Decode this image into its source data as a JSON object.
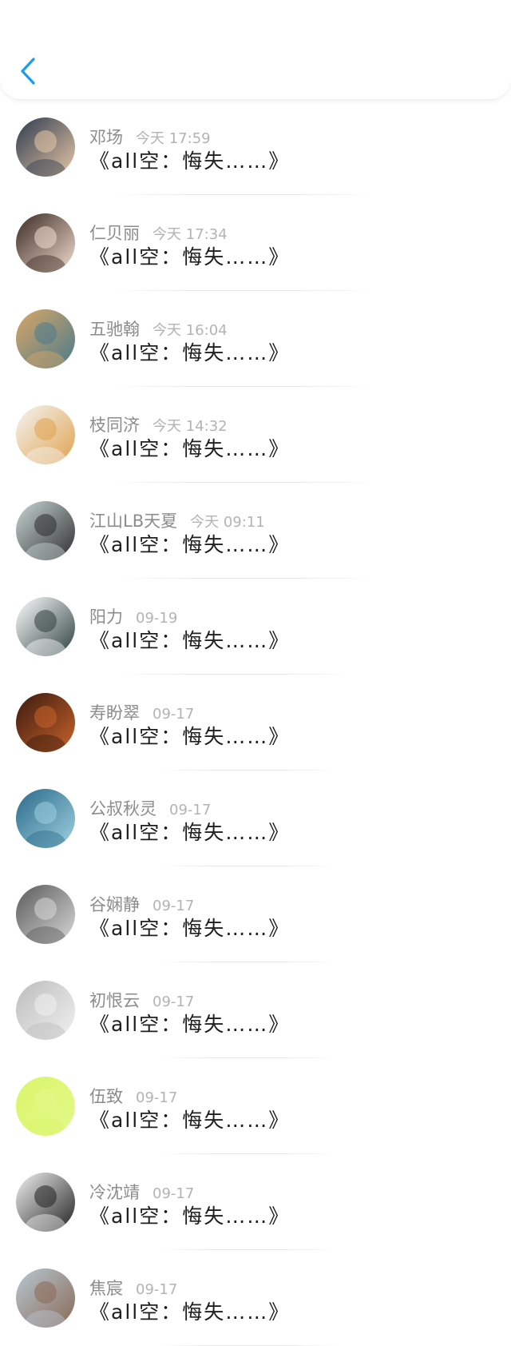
{
  "header": {
    "back_icon": "chevron-left-icon",
    "accent": "#1a9df1"
  },
  "messages": [
    {
      "name": "邓场",
      "time": "今天 17:59",
      "title": "《all空：悔失……》",
      "avatar_colors": [
        "#2c3a4d",
        "#e8c8a8"
      ]
    },
    {
      "name": "仁贝丽",
      "time": "今天 17:34",
      "title": "《all空：悔失……》",
      "avatar_colors": [
        "#3a2a22",
        "#f3ddd0"
      ]
    },
    {
      "name": "五驰翰",
      "time": "今天 16:04",
      "title": "《all空：悔失……》",
      "avatar_colors": [
        "#d9a766",
        "#4a7a8c"
      ]
    },
    {
      "name": "枝同济",
      "time": "今天 14:32",
      "title": "《all空：悔失……》",
      "avatar_colors": [
        "#f4f4f4",
        "#e0a350"
      ]
    },
    {
      "name": "江山LB天夏",
      "time": "今天 09:11",
      "title": "《all空：悔失……》",
      "avatar_colors": [
        "#c9d6d6",
        "#2e2e2e"
      ]
    },
    {
      "name": "阳力",
      "time": "09-19",
      "title": "《all空：悔失……》",
      "avatar_colors": [
        "#ffffff",
        "#2f4040"
      ]
    },
    {
      "name": "寿盼翠",
      "time": "09-17",
      "title": "《all空：悔失……》",
      "avatar_colors": [
        "#3a1a10",
        "#c8632a"
      ]
    },
    {
      "name": "公叔秋灵",
      "time": "09-17",
      "title": "《all空：悔失……》",
      "avatar_colors": [
        "#2a6a8a",
        "#9fd0e0"
      ]
    },
    {
      "name": "谷娴静",
      "time": "09-17",
      "title": "《all空：悔失……》",
      "avatar_colors": [
        "#5a5a5a",
        "#d8d8d8"
      ]
    },
    {
      "name": "初恨云",
      "time": "09-17",
      "title": "《all空：悔失……》",
      "avatar_colors": [
        "#bdbdbd",
        "#f0f0f0"
      ]
    },
    {
      "name": "伍致",
      "time": "09-17",
      "title": "《all空：悔失……》",
      "avatar_colors": [
        "#d9f56a",
        "#e2f98a"
      ]
    },
    {
      "name": "冷沈靖",
      "time": "09-17",
      "title": "《all空：悔失……》",
      "avatar_colors": [
        "#f2f2f2",
        "#222222"
      ]
    },
    {
      "name": "焦宸",
      "time": "09-17",
      "title": "《all空：悔失……》",
      "avatar_colors": [
        "#b7c7d4",
        "#8a6a55"
      ]
    }
  ]
}
